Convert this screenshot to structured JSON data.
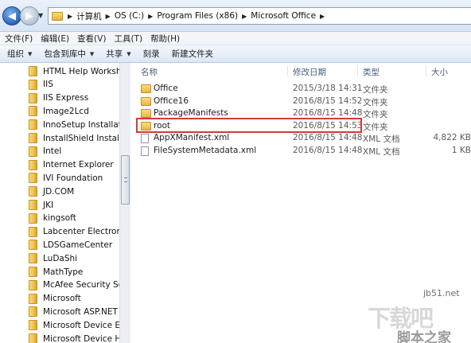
{
  "address": {
    "crumbs": [
      "计算机",
      "OS (C:)",
      "Program Files (x86)",
      "Microsoft Office"
    ],
    "separator": "▶"
  },
  "menu": [
    "文件(F)",
    "编辑(E)",
    "查看(V)",
    "工具(T)",
    "帮助(H)"
  ],
  "toolbar": {
    "organize": "组织",
    "include": "包含到库中",
    "share": "共享",
    "burn": "刻录",
    "new_folder": "新建文件夹"
  },
  "sidebar": {
    "items": [
      "HTML Help Workshop",
      "IIS",
      "IIS Express",
      "Image2Lcd",
      "InnoSetup Installation",
      "InstallShield Installation",
      "Intel",
      "Internet Explorer",
      "IVI Foundation",
      "JD.COM",
      "JKI",
      "kingsoft",
      "Labcenter Electronics",
      "LDSGameCenter",
      "LuDaShi",
      "MathType",
      "McAfee Security Scan",
      "Microsoft",
      "Microsoft ASP.NET",
      "Microsoft Device Emul",
      "Microsoft Device Healt"
    ]
  },
  "columns": {
    "name": "名称",
    "date": "修改日期",
    "type": "类型",
    "size": "大小"
  },
  "files": [
    {
      "name": "Office",
      "date": "2015/3/18 14:31",
      "type": "文件夹",
      "size": "",
      "kind": "folder"
    },
    {
      "name": "Office16",
      "date": "2016/8/15 14:52",
      "type": "文件夹",
      "size": "",
      "kind": "folder"
    },
    {
      "name": "PackageManifests",
      "date": "2016/8/15 14:48",
      "type": "文件夹",
      "size": "",
      "kind": "folder"
    },
    {
      "name": "root",
      "date": "2016/8/15 14:53",
      "type": "文件夹",
      "size": "",
      "kind": "folder"
    },
    {
      "name": "AppXManifest.xml",
      "date": "2016/8/15 14:48",
      "type": "XML 文档",
      "size": "4,822 KB",
      "kind": "xml"
    },
    {
      "name": "FileSystemMetadata.xml",
      "date": "2016/8/15 14:48",
      "type": "XML 文档",
      "size": "1 KB",
      "kind": "xml"
    }
  ],
  "watermark": {
    "url": "jb51.net",
    "big": "下载吧",
    "site": "脚本之家"
  }
}
